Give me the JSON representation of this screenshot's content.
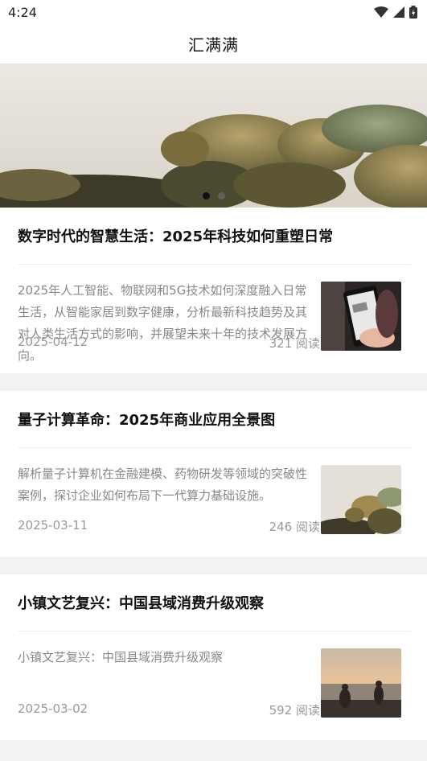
{
  "status_bar": {
    "time": "4:24"
  },
  "header": {
    "title": "汇满满"
  },
  "banner": {
    "slide_count": 2,
    "active_index": 0
  },
  "articles": [
    {
      "title": "数字时代的智慧生活：2025年科技如何重塑日常",
      "summary": "2025年人工智能、物联网和5G技术如何深度融入日常生活，从智能家居到数字健康，分析最新科技趋势及其对人类生活方式的影响，并展望未来十年的技术发展方向。",
      "date": "2025-04-12",
      "reads": "321 阅读",
      "thumbnail": "phone-photo"
    },
    {
      "title": "量子计算革命：2025年商业应用全景图",
      "summary": "解析量子计算机在金融建模、药物研发等领域的突破性案例，探讨企业如何布局下一代算力基础设施。",
      "date": "2025-03-11",
      "reads": "246 阅读",
      "thumbnail": "cactus-photo"
    },
    {
      "title": "小镇文艺复兴：中国县域消费升级观察",
      "summary": "小镇文艺复兴：中国县域消费升级观察",
      "date": "2025-03-02",
      "reads": "592 阅读",
      "thumbnail": "sunset-photo"
    }
  ]
}
